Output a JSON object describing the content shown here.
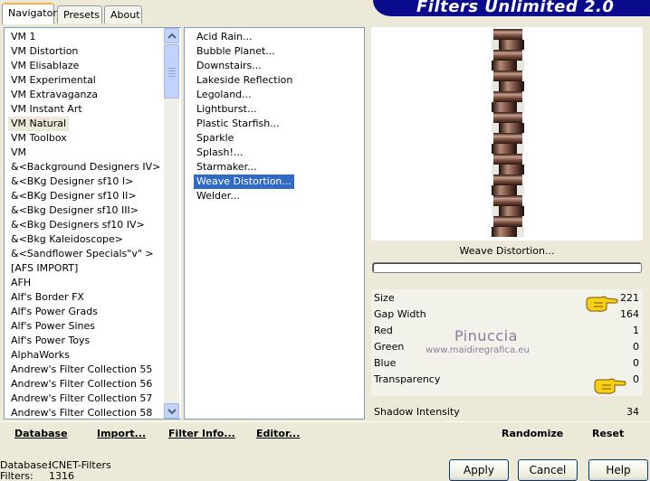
{
  "tabs": [
    {
      "label": "Navigator",
      "active": true
    },
    {
      "label": "Presets",
      "active": false
    },
    {
      "label": "About",
      "active": false
    }
  ],
  "banner_title": "Filters Unlimited 2.0",
  "categories": [
    "VM 1",
    "VM Distortion",
    "VM Elisablaze",
    "VM Experimental",
    "VM Extravaganza",
    "VM Instant Art",
    "VM Natural",
    "VM Toolbox",
    "VM",
    "&<Background Designers IV>",
    "&<BKg Designer sf10 I>",
    "&<BKg Designer sf10 II>",
    "&<Bkg Designer sf10 III>",
    "&<Bkg Designers sf10 IV>",
    "&<Bkg Kaleidoscope>",
    "&<Sandflower Specials\"v\" >",
    "[AFS IMPORT]",
    "AFH",
    "Alf's Border FX",
    "Alf's Power Grads",
    "Alf's Power Sines",
    "Alf's Power Toys",
    "AlphaWorks",
    "Andrew's Filter Collection 55",
    "Andrew's Filter Collection 56",
    "Andrew's Filter Collection 57",
    "Andrew's Filter Collection 58"
  ],
  "selected_category": "VM Natural",
  "filters": [
    "Acid Rain...",
    "Bubble Planet...",
    "Downstairs...",
    "Lakeside Reflection",
    "Legoland...",
    "Lightburst...",
    "Plastic Starfish...",
    "Sparkle",
    "Splash!...",
    "Starmaker...",
    "Weave Distortion...",
    "Welder..."
  ],
  "selected_filter": "Weave Distortion...",
  "filter_name_label": "Weave Distortion...",
  "parameters": [
    {
      "label": "Size",
      "value": "221"
    },
    {
      "label": "Gap Width",
      "value": "164"
    },
    {
      "label": "Red",
      "value": "1"
    },
    {
      "label": "Green",
      "value": "0"
    },
    {
      "label": "Blue",
      "value": "0"
    },
    {
      "label": "Transparency",
      "value": "0"
    },
    {
      "label": "Shadow Intensity",
      "value": "34"
    }
  ],
  "watermark": {
    "name": "Pinuccia",
    "url": "www.maidiregrafica.eu"
  },
  "actions": {
    "database": "Database",
    "import": "Import...",
    "filter_info": "Filter Info...",
    "editor": "Editor...",
    "randomize": "Randomize",
    "reset": "Reset"
  },
  "status": {
    "database_label": "Database:",
    "database_value": "ICNET-Filters",
    "filters_label": "Filters:",
    "filters_value": "1316"
  },
  "buttons": {
    "apply": "Apply",
    "cancel": "Cancel",
    "help": "Help"
  },
  "icons": {
    "scroll_up": "chevron-up-icon",
    "scroll_down": "chevron-down-icon",
    "hand": "pointing-hand-icon"
  },
  "colors": {
    "banner": "#0a0a8c",
    "selection": "#316ac5",
    "active_tab_accent": "#f7b04a",
    "preview_strip_brown": "#5a3a2a",
    "watermark": "#8a7d99"
  }
}
